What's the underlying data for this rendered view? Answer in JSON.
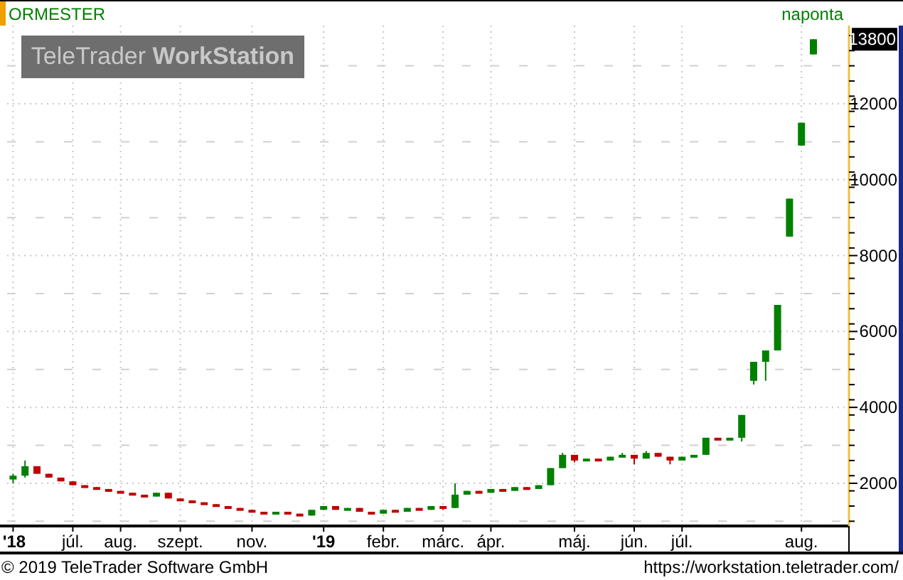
{
  "header": {
    "interval": "naponta"
  },
  "logo": "TeleTrader **WorkStation**",
  "chart_data": {
    "type": "candlestick",
    "annotations": [
      "13800"
    ],
    "categories": [
      "'18",
      null,
      null,
      null,
      null,
      "júl.",
      null,
      null,
      null,
      "aug.",
      null,
      null,
      null,
      null,
      "szept.",
      null,
      null,
      null,
      null,
      null,
      "nov.",
      null,
      null,
      null,
      null,
      null,
      "'19",
      null,
      null,
      null,
      null,
      "febr.",
      null,
      null,
      null,
      null,
      "márc.",
      null,
      null,
      null,
      "ápr.",
      null,
      null,
      null,
      null,
      null,
      null,
      "máj.",
      null,
      null,
      null,
      null,
      "jún.",
      null,
      null,
      null,
      "júl.",
      null,
      null,
      null,
      null,
      null,
      null,
      null,
      null,
      null,
      "aug.",
      null
    ],
    "series": [
      {
        "name": "ORMESTER",
        "ohlc": [
          [
            2100,
            2250,
            2000,
            2200
          ],
          [
            2200,
            2600,
            2150,
            2450
          ],
          [
            2450,
            2450,
            2250,
            2250
          ],
          [
            2250,
            2250,
            2150,
            2150
          ],
          [
            2150,
            2150,
            2050,
            2050
          ],
          [
            2050,
            2050,
            1950,
            1950
          ],
          [
            1950,
            1950,
            1900,
            1900
          ],
          [
            1900,
            1900,
            1850,
            1850
          ],
          [
            1850,
            1850,
            1800,
            1800
          ],
          [
            1800,
            1800,
            1750,
            1750
          ],
          [
            1750,
            1750,
            1700,
            1700
          ],
          [
            1700,
            1700,
            1650,
            1650
          ],
          [
            1650,
            1750,
            1650,
            1750
          ],
          [
            1750,
            1750,
            1600,
            1600
          ],
          [
            1600,
            1600,
            1550,
            1550
          ],
          [
            1550,
            1550,
            1500,
            1500
          ],
          [
            1500,
            1500,
            1450,
            1450
          ],
          [
            1450,
            1450,
            1400,
            1400
          ],
          [
            1400,
            1400,
            1350,
            1350
          ],
          [
            1350,
            1350,
            1300,
            1300
          ],
          [
            1300,
            1300,
            1250,
            1250
          ],
          [
            1250,
            1250,
            1200,
            1200
          ],
          [
            1200,
            1250,
            1200,
            1250
          ],
          [
            1250,
            1250,
            1200,
            1200
          ],
          [
            1200,
            1200,
            1150,
            1150
          ],
          [
            1150,
            1300,
            1150,
            1300
          ],
          [
            1300,
            1400,
            1300,
            1400
          ],
          [
            1400,
            1400,
            1300,
            1300
          ],
          [
            1300,
            1350,
            1300,
            1350
          ],
          [
            1350,
            1350,
            1250,
            1250
          ],
          [
            1250,
            1250,
            1200,
            1200
          ],
          [
            1200,
            1300,
            1200,
            1300
          ],
          [
            1300,
            1300,
            1250,
            1250
          ],
          [
            1250,
            1350,
            1250,
            1350
          ],
          [
            1350,
            1350,
            1300,
            1300
          ],
          [
            1300,
            1400,
            1300,
            1400
          ],
          [
            1400,
            1400,
            1300,
            1350
          ],
          [
            1350,
            2000,
            1350,
            1700
          ],
          [
            1700,
            1800,
            1700,
            1800
          ],
          [
            1800,
            1800,
            1750,
            1750
          ],
          [
            1750,
            1850,
            1750,
            1850
          ],
          [
            1850,
            1850,
            1800,
            1800
          ],
          [
            1800,
            1900,
            1800,
            1900
          ],
          [
            1900,
            1900,
            1850,
            1850
          ],
          [
            1850,
            1950,
            1850,
            1950
          ],
          [
            1950,
            2400,
            1950,
            2400
          ],
          [
            2400,
            2800,
            2400,
            2750
          ],
          [
            2750,
            2750,
            2550,
            2600
          ],
          [
            2600,
            2650,
            2600,
            2650
          ],
          [
            2650,
            2650,
            2600,
            2600
          ],
          [
            2600,
            2700,
            2600,
            2700
          ],
          [
            2700,
            2800,
            2700,
            2750
          ],
          [
            2750,
            2750,
            2500,
            2650
          ],
          [
            2650,
            2850,
            2650,
            2800
          ],
          [
            2800,
            2800,
            2700,
            2700
          ],
          [
            2700,
            2700,
            2500,
            2600
          ],
          [
            2600,
            2700,
            2600,
            2700
          ],
          [
            2700,
            2750,
            2700,
            2750
          ],
          [
            2750,
            3200,
            2750,
            3200
          ],
          [
            3200,
            3200,
            3150,
            3150
          ],
          [
            3150,
            3200,
            3150,
            3200
          ],
          [
            3200,
            3800,
            3100,
            3800
          ],
          [
            4700,
            5200,
            4600,
            5200
          ],
          [
            5200,
            5500,
            4700,
            5500
          ],
          [
            5500,
            6700,
            5500,
            6700
          ],
          [
            8500,
            9500,
            8500,
            9500
          ],
          [
            10900,
            11500,
            10900,
            11500
          ],
          [
            13300,
            13700,
            13300,
            13700
          ]
        ]
      }
    ],
    "ylim": [
      875,
      14060
    ],
    "grid": true,
    "yticks": [
      2000,
      4000,
      6000,
      8000,
      10000,
      12000
    ]
  },
  "footer": {
    "copyright": "© 2019 TeleTrader Software GmbH",
    "url": "https://workstation.teletrader.com/"
  }
}
